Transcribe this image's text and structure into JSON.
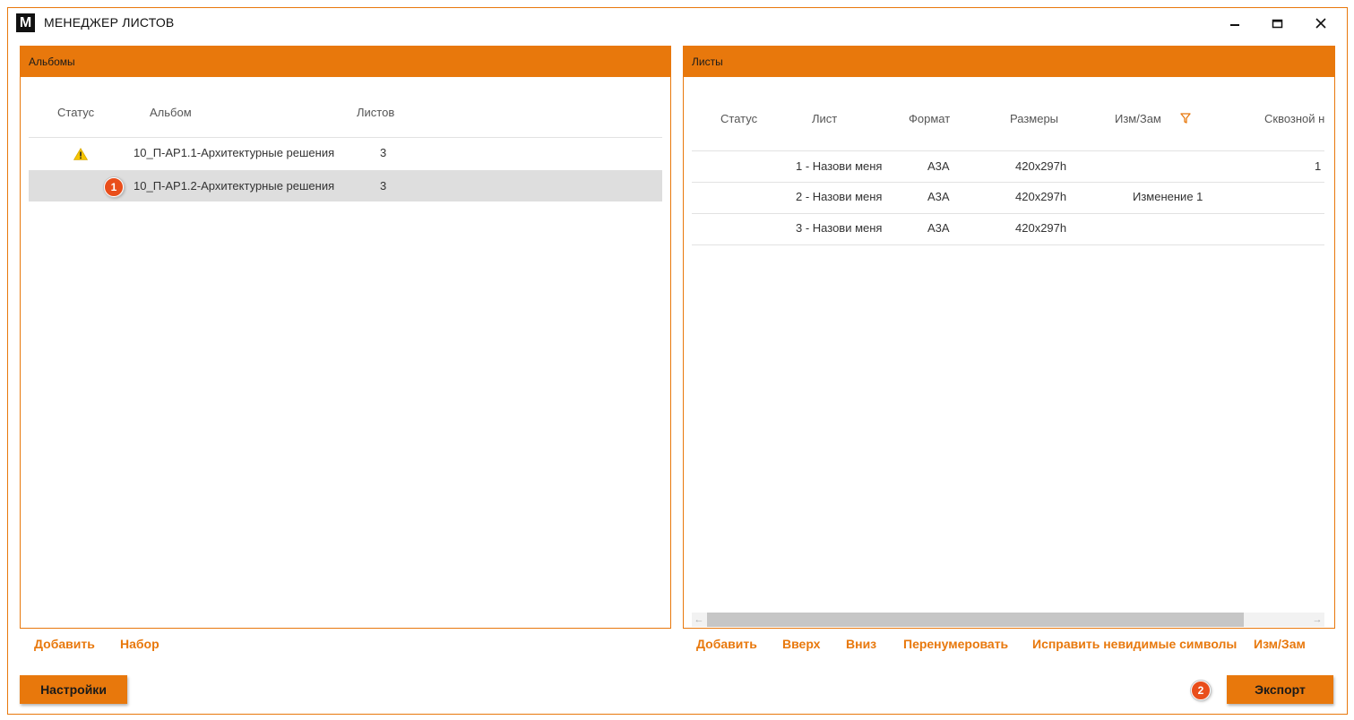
{
  "window": {
    "logo": "M",
    "title": "МЕНЕДЖЕР ЛИСТОВ",
    "buttons": [
      "minimize-icon",
      "maximize-icon",
      "close-icon"
    ]
  },
  "albums_panel": {
    "header": "Альбомы",
    "columns": {
      "status": "Статус",
      "album": "Альбом",
      "sheets": "Листов"
    },
    "rows": [
      {
        "status_icon": "warning-icon",
        "album": "10_П-АР1.1-Архитектурные решения",
        "sheets": "3",
        "selected": false
      },
      {
        "status_icon": "",
        "album": "10_П-АР1.2-Архитектурные решения",
        "sheets": "3",
        "selected": true
      }
    ],
    "actions": {
      "add": "Добавить",
      "set": "Набор"
    }
  },
  "sheets_panel": {
    "header": "Листы",
    "columns": {
      "status": "Статус",
      "sheet": "Лист",
      "format": "Формат",
      "size": "Размеры",
      "change": "Изм/Зам",
      "through": "Сквозной н"
    },
    "rows": [
      {
        "sheet": "1 - Назови меня",
        "format": "А3А",
        "size": "420x297h",
        "change": "",
        "through": "1"
      },
      {
        "sheet": "2 - Назови меня",
        "format": "А3А",
        "size": "420x297h",
        "change": "Изменение 1",
        "through": ""
      },
      {
        "sheet": "3 - Назови меня",
        "format": "А3А",
        "size": "420x297h",
        "change": "",
        "through": ""
      }
    ],
    "actions": {
      "add": "Добавить",
      "up": "Вверх",
      "down": "Вниз",
      "renumber": "Перенумеровать",
      "fix_symbols": "Исправить невидимые символы",
      "change": "Изм/Зам"
    }
  },
  "footer": {
    "settings": "Настройки",
    "export": "Экспорт"
  },
  "annotations": {
    "badge1": "1",
    "badge2": "2"
  },
  "colors": {
    "accent": "#e8780c",
    "badge": "#e94e1b",
    "selected_row": "#dedede",
    "warning": "#f5c400"
  }
}
